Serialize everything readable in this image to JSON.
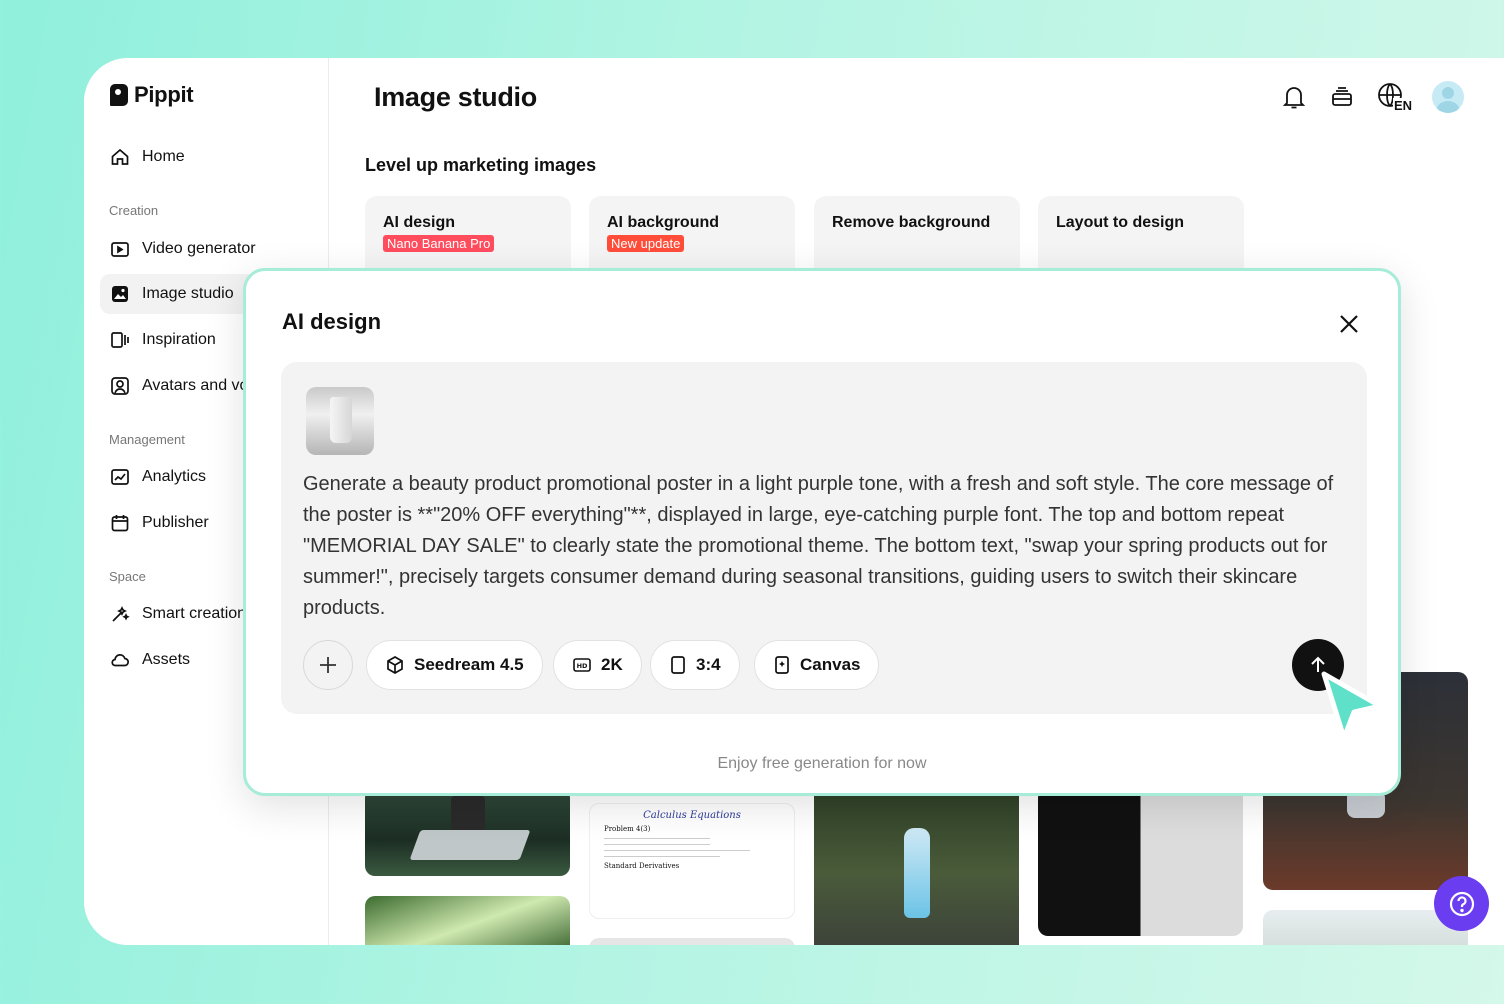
{
  "brand": {
    "name": "Pippit"
  },
  "sidebar": {
    "home": "Home",
    "sections": [
      "Creation",
      "Management",
      "Space"
    ],
    "creation": [
      "Video generator",
      "Image studio",
      "Inspiration",
      "Avatars and voices"
    ],
    "management": [
      "Analytics",
      "Publisher"
    ],
    "space": [
      "Smart creation",
      "Assets"
    ]
  },
  "header": {
    "title": "Image studio",
    "language": "EN"
  },
  "main": {
    "subtitle": "Level up marketing images",
    "tools": [
      {
        "label": "AI design",
        "badge": "Nano Banana Pro"
      },
      {
        "label": "AI background",
        "badge": "New update"
      },
      {
        "label": "Remove background",
        "badge": ""
      },
      {
        "label": "Layout to design",
        "badge": ""
      }
    ],
    "gallery_text": {
      "calculus_title": "Calculus Equations",
      "calculus_problem": "Problem 4(3)",
      "calculus_sub": "Standard Derivatives"
    }
  },
  "dialog": {
    "title": "AI design",
    "prompt": "Generate a beauty product promotional poster in a light purple tone, with a fresh and soft style. The core message of the poster is **\"20% OFF everything\"**, displayed in large, eye-catching purple font. The top and bottom repeat \"MEMORIAL DAY SALE\" to clearly state the promotional theme. The bottom text, \"swap your spring products out for summer!\", precisely targets consumer demand during seasonal transitions, guiding users to switch their skincare products.",
    "model": "Seedream 4.5",
    "resolution": "2K",
    "ratio": "3:4",
    "canvas": "Canvas",
    "footer": "Enjoy free generation for now"
  },
  "colors": {
    "accent": "#6a3df0",
    "badge": "#ff4d5e",
    "cursor": "#5fe0c8"
  }
}
